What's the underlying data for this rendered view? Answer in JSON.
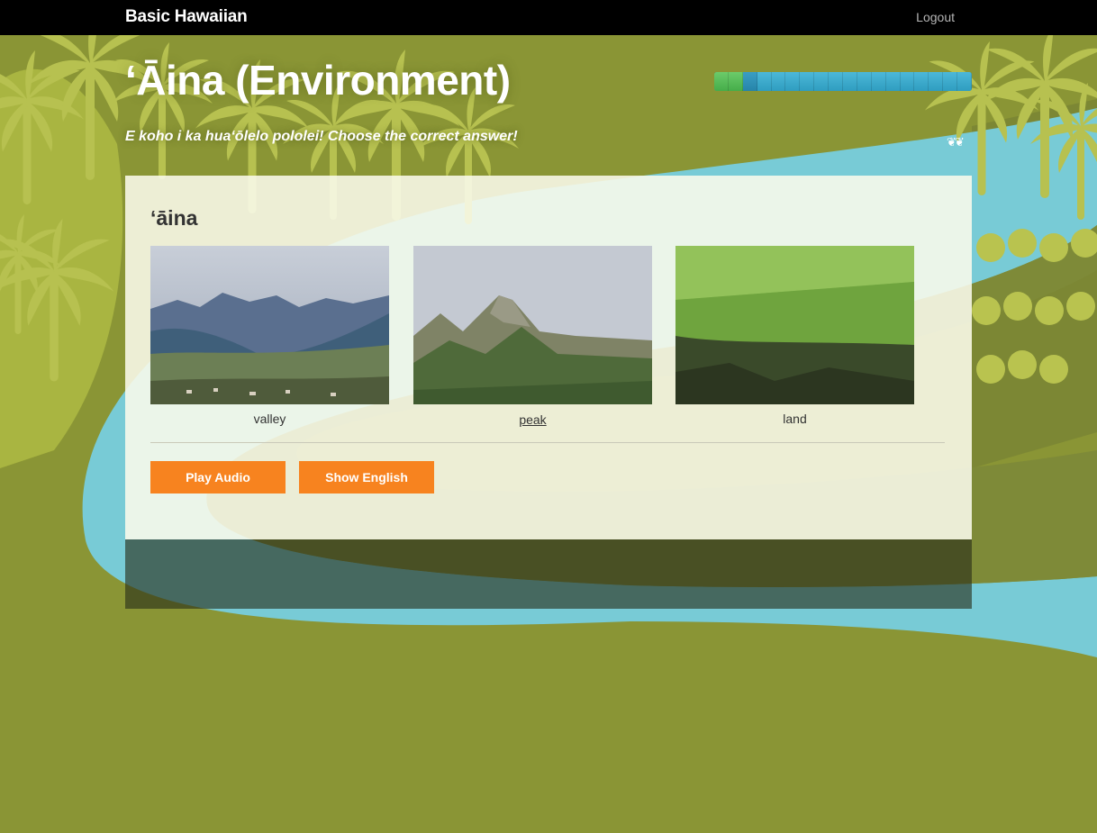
{
  "nav": {
    "brand": "Basic Hawaiian",
    "logout": "Logout"
  },
  "lesson": {
    "title": "ʻĀina (Environment)",
    "instructions": "E koho i ka huaʻōlelo pololei! Choose the correct answer!",
    "leaf_icons": "❦❦"
  },
  "progress": {
    "total_steps": 18,
    "completed": 2,
    "current": 3
  },
  "question": {
    "word": "ʻāina",
    "choices": [
      {
        "label": "valley",
        "image": "valley-photo"
      },
      {
        "label": "peak",
        "image": "mountain-peak-photo"
      },
      {
        "label": "land",
        "image": "grass-land-photo"
      }
    ]
  },
  "actions": {
    "play_audio": "Play Audio",
    "show_english": "Show English"
  },
  "colors": {
    "background": "#8a9535",
    "accent_button": "#f7831f",
    "progress_done": "#4cb04e",
    "progress_remaining": "#39a8c9"
  }
}
